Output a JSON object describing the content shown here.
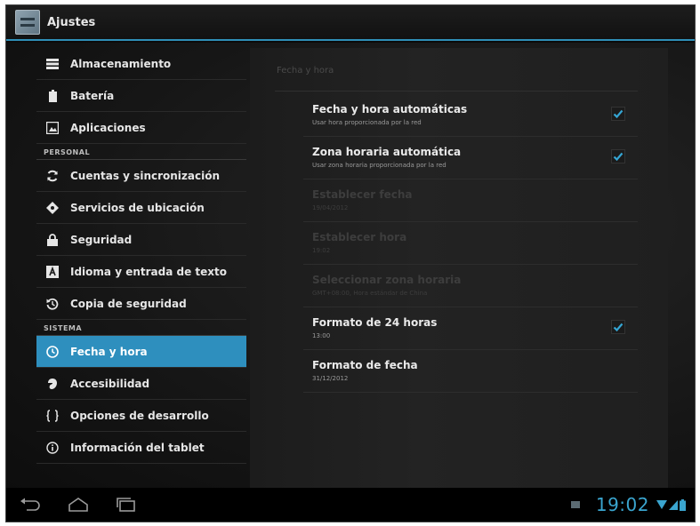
{
  "app": {
    "title": "Ajustes"
  },
  "sidebar": {
    "items_top": [
      {
        "label": "Almacenamiento",
        "icon": "storage-icon"
      },
      {
        "label": "Batería",
        "icon": "battery-icon"
      },
      {
        "label": "Aplicaciones",
        "icon": "apps-icon"
      }
    ],
    "header_personal": "PERSONAL",
    "items_personal": [
      {
        "label": "Cuentas y sincronización",
        "icon": "sync-icon"
      },
      {
        "label": "Servicios de ubicación",
        "icon": "location-icon"
      },
      {
        "label": "Seguridad",
        "icon": "lock-icon"
      },
      {
        "label": "Idioma y entrada de texto",
        "icon": "language-icon"
      },
      {
        "label": "Copia de seguridad",
        "icon": "backup-icon"
      }
    ],
    "header_sistema": "SISTEMA",
    "items_sistema": [
      {
        "label": "Fecha y hora",
        "icon": "clock-icon",
        "selected": true
      },
      {
        "label": "Accesibilidad",
        "icon": "accessibility-icon"
      },
      {
        "label": "Opciones de desarrollo",
        "icon": "braces-icon"
      },
      {
        "label": "Información del tablet",
        "icon": "info-icon"
      }
    ]
  },
  "panel": {
    "title": "Fecha y hora",
    "rows": [
      {
        "title": "Fecha y hora automáticas",
        "subtitle": "Usar hora proporcionada por la red",
        "checked": true,
        "enabled": true
      },
      {
        "title": "Zona horaria automática",
        "subtitle": "Usar zona horaria proporcionada por la red",
        "checked": true,
        "enabled": true
      },
      {
        "title": "Establecer fecha",
        "subtitle": "19/04/2012",
        "checked": null,
        "enabled": false
      },
      {
        "title": "Establecer hora",
        "subtitle": "19:02",
        "checked": null,
        "enabled": false
      },
      {
        "title": "Seleccionar zona horaria",
        "subtitle": "GMT+08:00, Hora estándar de China",
        "checked": null,
        "enabled": false
      },
      {
        "title": "Formato de 24 horas",
        "subtitle": "13:00",
        "checked": true,
        "enabled": true
      },
      {
        "title": "Formato de fecha",
        "subtitle": "31/12/2012",
        "checked": null,
        "enabled": true
      }
    ]
  },
  "statusbar": {
    "time": "19:02"
  },
  "colors": {
    "accent": "#2e8fbe",
    "check": "#35a6d4",
    "clock": "#3aa5cf"
  }
}
